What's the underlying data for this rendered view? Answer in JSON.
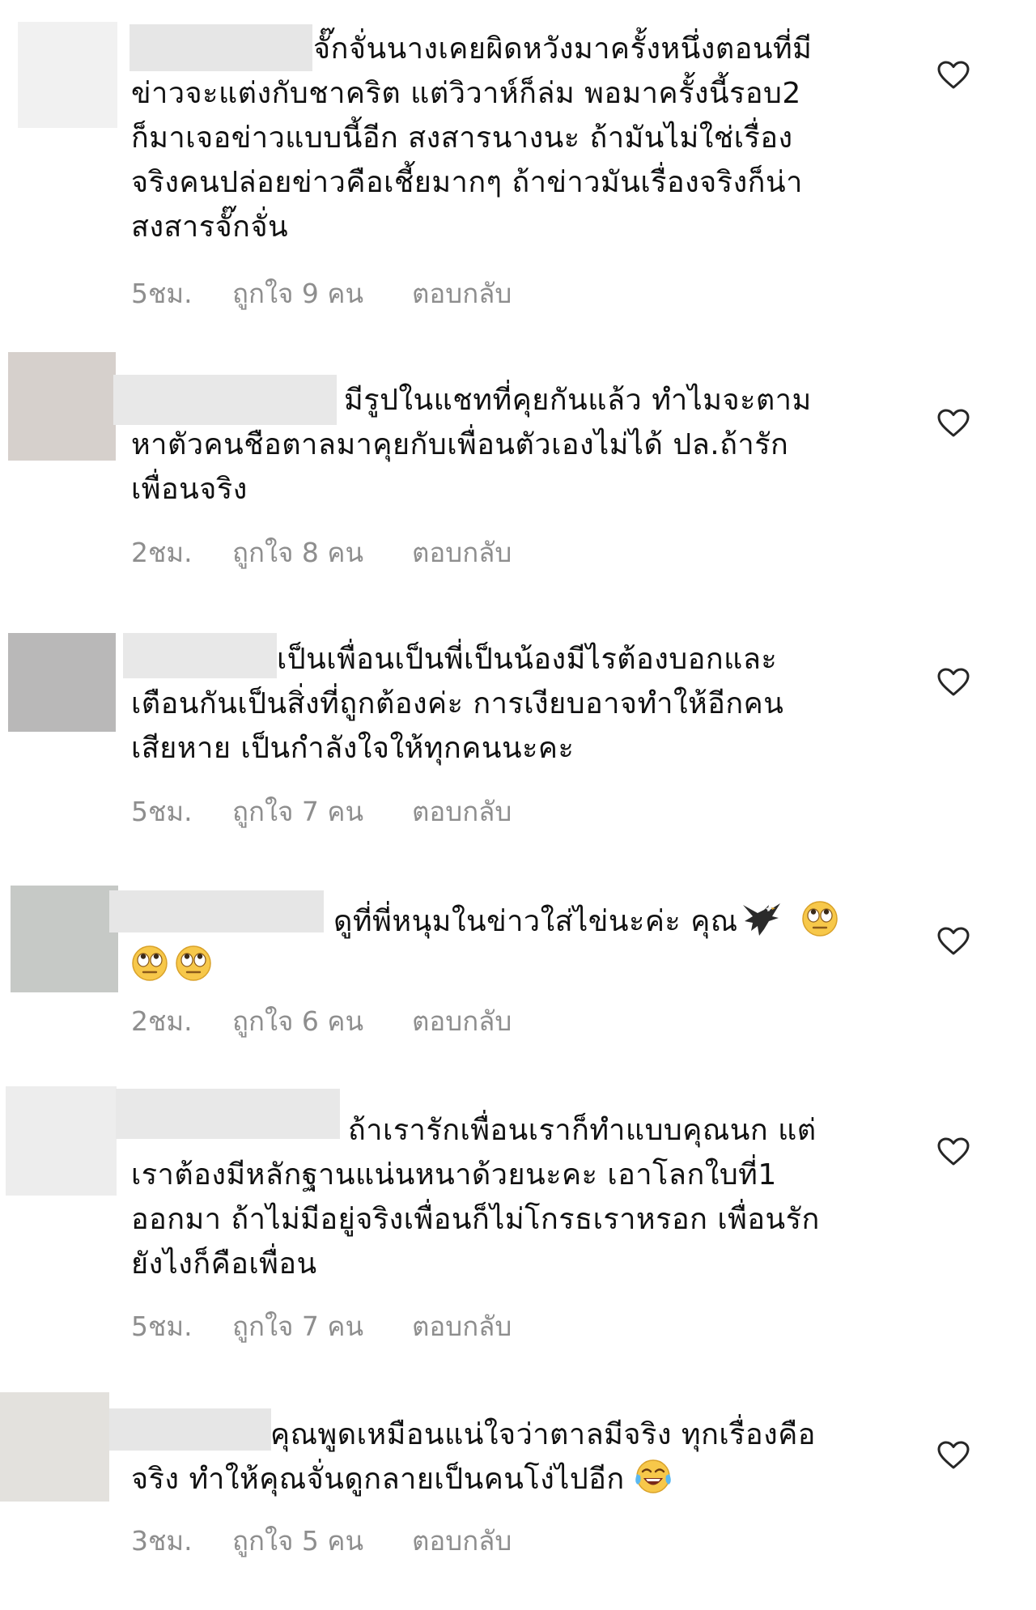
{
  "colors": {
    "meta_text": "#8e8e8e",
    "body_text": "#111111",
    "heart_outline": "#262626"
  },
  "comments": [
    {
      "lines": [
        "จั๊กจั่นนางเคยผิดหวังมาครั้งหนึ่งตอนที่มี",
        "ข่าวจะแต่งกับชาคริต แต่วิวาห์ก็ล่ม พอมาครั้งนี้รอบ2",
        "ก็มาเจอข่าวแบบนี้อีก สงสารนางนะ ถ้ามันไม่ใช่เรื่อง",
        "จริงคนปล่อยข่าวคือเชี้ยมากๆ ถ้าข่าวมันเรื่องจริงก็น่า",
        "สงสารจั๊กจั่น"
      ],
      "time": "5ชม.",
      "likes": "ถูกใจ 9 คน",
      "reply": "ตอบกลับ",
      "heart_icon": "heart-outline-icon"
    },
    {
      "lines": [
        "มีรูปในแชทที่คุยกันแล้ว ทำไมจะตาม",
        "หาตัวคนชือตาลมาคุยกับเพื่อนตัวเองไม่ได้ ปล.ถ้ารัก",
        "เพื่อนจริง"
      ],
      "time": "2ชม.",
      "likes": "ถูกใจ 8 คน",
      "reply": "ตอบกลับ",
      "heart_icon": "heart-outline-icon"
    },
    {
      "lines": [
        "เป็นเพื่อนเป็นพี่เป็นน้องมีไรต้องบอกและ",
        "เตือนกันเป็นสิ่งที่ถูกต้องค่ะ การเงียบอาจทำให้อีกคน",
        "เสียหาย เป็นกำลังใจให้ทุกคนนะคะ"
      ],
      "time": "5ชม.",
      "likes": "ถูกใจ 7 คน",
      "reply": "ตอบกลับ",
      "heart_icon": "heart-outline-icon"
    },
    {
      "lines": [
        "ดูที่พี่หนุมในข่าวใส่ไข่นะค่ะ คุณ"
      ],
      "emoji_icons": [
        "eagle-icon",
        "face-with-rolling-eyes-icon",
        "face-with-rolling-eyes-icon",
        "face-with-rolling-eyes-icon"
      ],
      "time": "2ชม.",
      "likes": "ถูกใจ 6 คน",
      "reply": "ตอบกลับ",
      "heart_icon": "heart-outline-icon"
    },
    {
      "lines": [
        "ถ้าเรารักเพื่อนเราก็ทำแบบคุณนก แต่",
        "เราต้องมีหลักฐานแน่นหนาด้วยนะคะ เอาโลกใบที่1",
        "ออกมา ถ้าไม่มีอยู่จริงเพื่อนก็ไม่โกรธเราหรอก เพื่อนรัก",
        "ยังไงก็คือเพื่อน"
      ],
      "time": "5ชม.",
      "likes": "ถูกใจ 7 คน",
      "reply": "ตอบกลับ",
      "heart_icon": "heart-outline-icon"
    },
    {
      "lines": [
        "คุณพูดเหมือนแน่ใจว่าตาลมีจริง ทุกเรื่องคือ",
        "จริง ทำให้คุณจั่นดูกลายเป็นคนโง่ไปอีก"
      ],
      "emoji_icons": [
        "face-with-tears-of-joy-icon"
      ],
      "time": "3ชม.",
      "likes": "ถูกใจ 5 คน",
      "reply": "ตอบกลับ",
      "heart_icon": "heart-outline-icon"
    }
  ]
}
